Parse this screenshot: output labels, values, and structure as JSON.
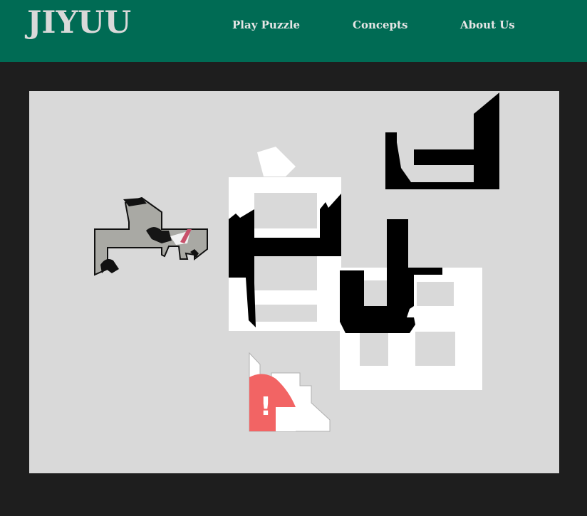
{
  "header": {
    "logo": "JIYUU",
    "nav": {
      "play_puzzle": "Play Puzzle",
      "concepts": "Concepts",
      "about_us": "About Us"
    }
  },
  "colors": {
    "header_bg": "#006b54",
    "page_bg": "#1e1e1e",
    "board_bg": "#d9d9d9",
    "piece_white": "#ffffff",
    "piece_black": "#000000",
    "accent_red": "#f26464"
  },
  "puzzle": {
    "piece_count": 6,
    "pieces": [
      {
        "name": "photo-fragment-piece",
        "fill": "#a9a9a4"
      },
      {
        "name": "white-frame-piece",
        "fill": "#ffffff"
      },
      {
        "name": "black-bracket-piece",
        "fill": "#000000"
      },
      {
        "name": "black-corner-piece",
        "fill": "#000000"
      },
      {
        "name": "white-grid-piece",
        "fill": "#ffffff"
      },
      {
        "name": "red-alert-piece",
        "fill": "#f26464",
        "glyph": "!"
      }
    ]
  }
}
